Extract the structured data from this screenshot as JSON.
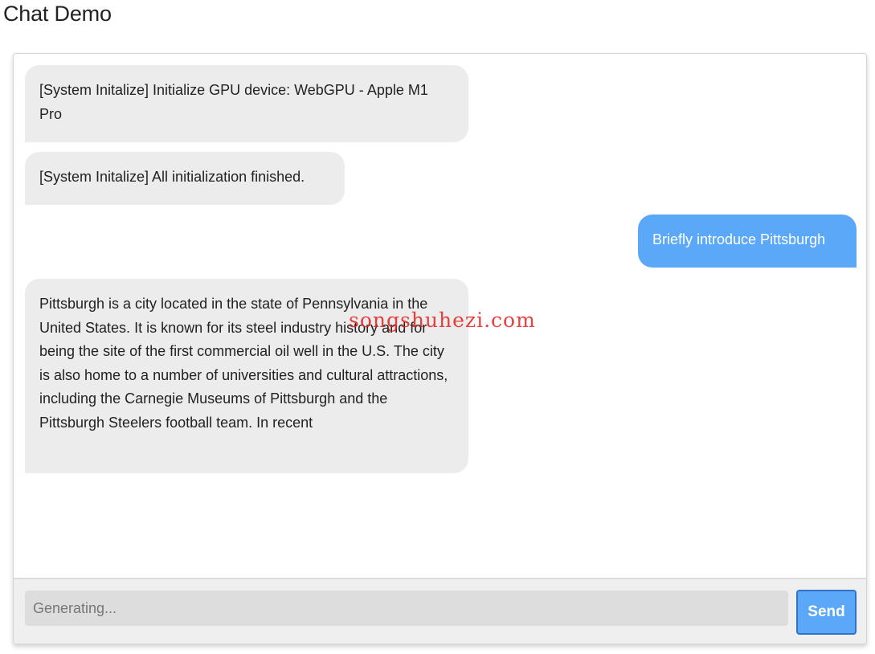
{
  "page": {
    "title": "Chat Demo"
  },
  "chat": {
    "messages": [
      {
        "role": "system",
        "text": "[System Initalize] Initialize GPU device: WebGPU - Apple M1 Pro"
      },
      {
        "role": "system",
        "text": "[System Initalize] All initialization finished."
      },
      {
        "role": "user",
        "text": "Briefly introduce Pittsburgh"
      },
      {
        "role": "assistant",
        "text": "Pittsburgh is a city located in the state of Pennsylvania in the United States. It is known for its steel industry history and for being the site of the first commercial oil well in the U.S. The city is also home to a number of universities and cultural attractions, including the Carnegie Museums of Pittsburgh and the Pittsburgh Steelers football team. In recent"
      }
    ],
    "input": {
      "value": "",
      "placeholder": "Generating..."
    },
    "send_label": "Send"
  },
  "watermark": "songshuhezi.com",
  "colors": {
    "user_bubble": "#5ba8f9",
    "bot_bubble": "#ececec",
    "send_border": "#2f72c8"
  }
}
